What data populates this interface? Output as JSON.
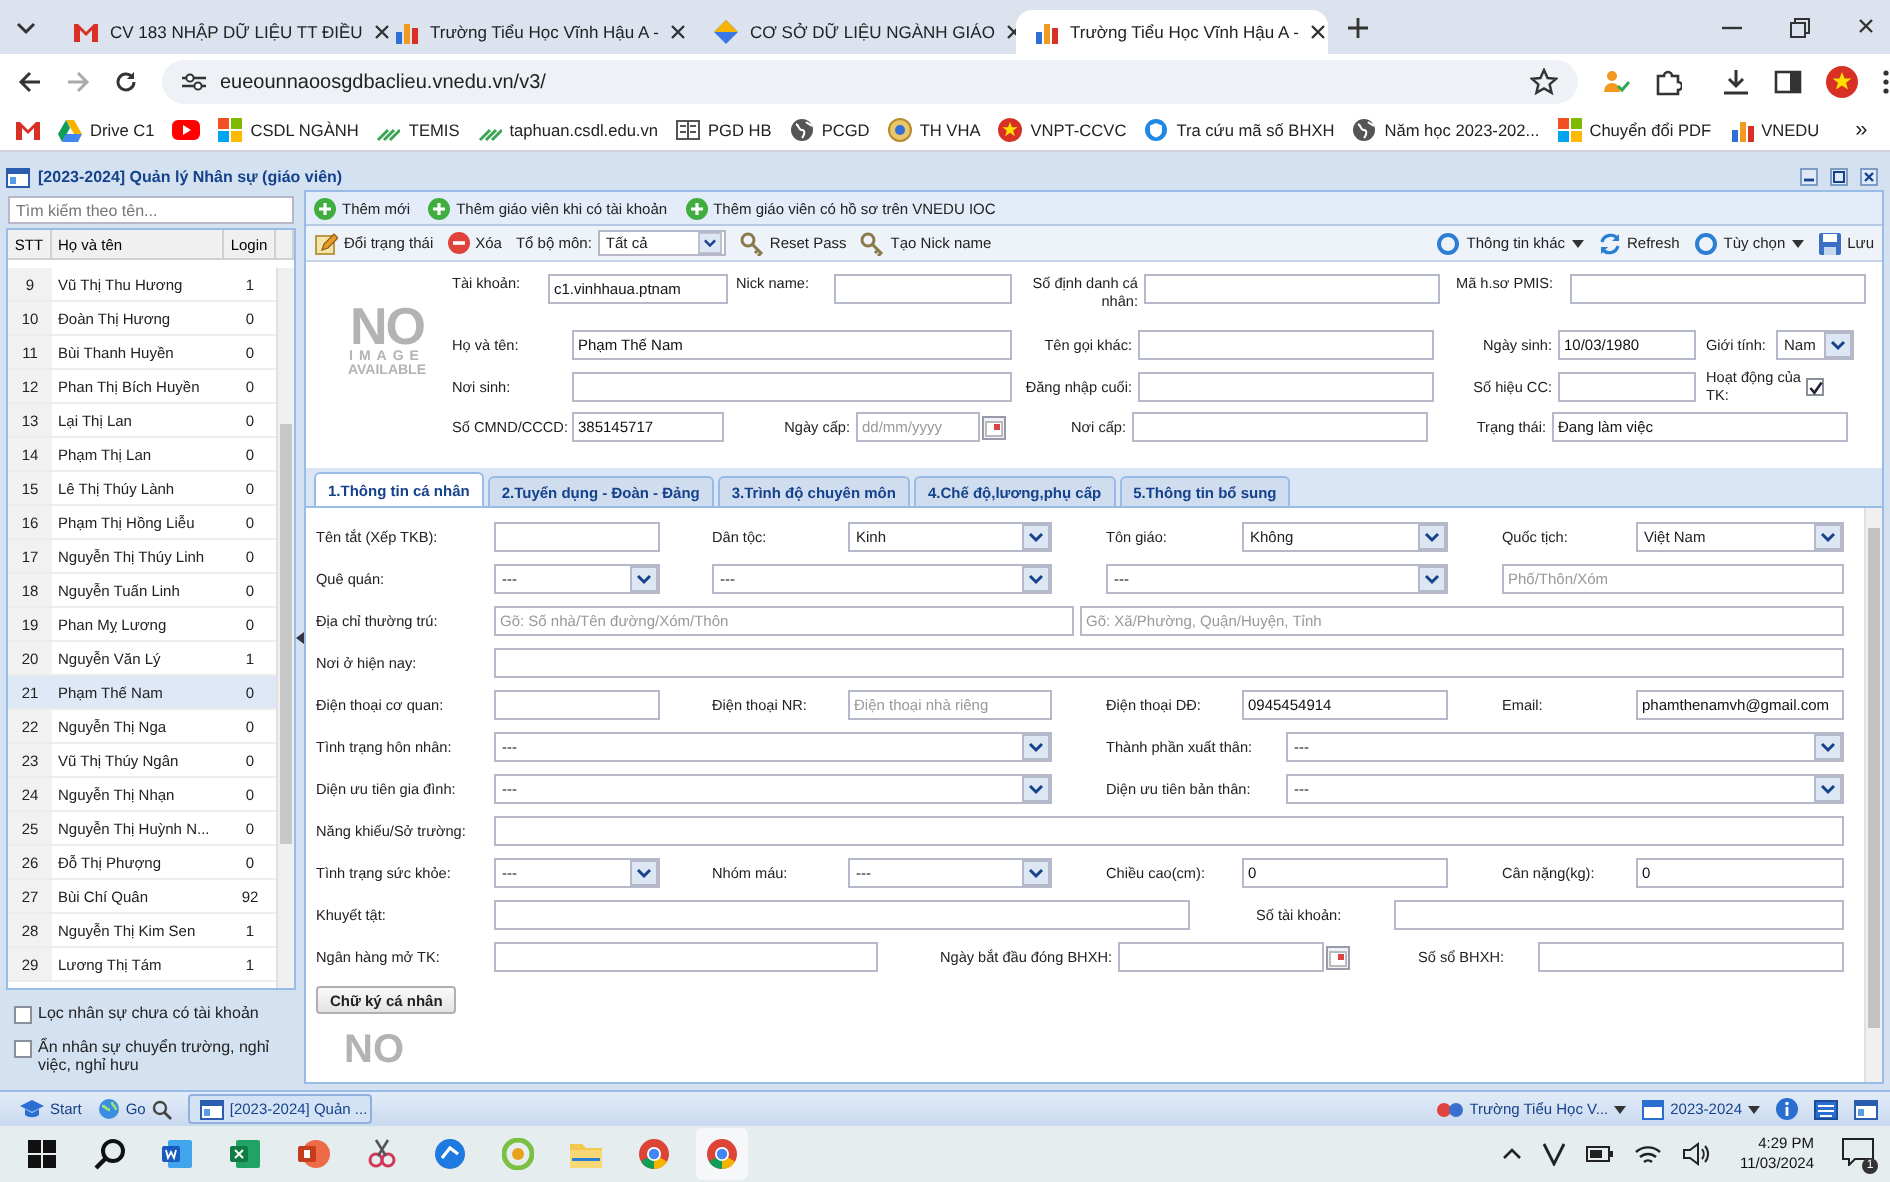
{
  "browser": {
    "tabs": [
      {
        "title": "CV 183 NHẬP DỮ LIỆU TT ĐIỀU",
        "selected": false
      },
      {
        "title": "Trường Tiểu Học Vĩnh Hậu A -",
        "selected": false
      },
      {
        "title": "CƠ SỞ DỮ LIỆU NGÀNH GIÁO",
        "selected": false
      },
      {
        "title": "Trường Tiểu Học Vĩnh Hậu A -",
        "selected": true
      }
    ],
    "address": "eueounnaoosgdbaclieu.vnedu.vn/v3/",
    "bookmarks": [
      "Drive C1",
      "CSDL NGÀNH",
      "TEMIS",
      "taphuan.csdl.edu.vn",
      "PGD HB",
      "PCGD",
      "TH VHA",
      "VNPT-CCVC",
      "Tra cứu mã số BHXH",
      "Năm học 2023-202...",
      "Chuyển đổi PDF",
      "VNEDU"
    ],
    "more": "»"
  },
  "app": {
    "title": "[2023-2024] Quản lý Nhân sự (giáo viên)",
    "sidebar": {
      "search_placeholder": "Tìm kiếm theo tên...",
      "columns": [
        "STT",
        "Họ và tên",
        "Login"
      ],
      "rows": [
        {
          "stt": "9",
          "name": "Vũ Thị Thu Hương",
          "login": "1",
          "selected": false
        },
        {
          "stt": "10",
          "name": "Đoàn Thị Hương",
          "login": "0",
          "selected": false
        },
        {
          "stt": "11",
          "name": "Bùi Thanh Huyền",
          "login": "0",
          "selected": false
        },
        {
          "stt": "12",
          "name": "Phan Thị Bích Huyền",
          "login": "0",
          "selected": false
        },
        {
          "stt": "13",
          "name": "Lại Thị Lan",
          "login": "0",
          "selected": false
        },
        {
          "stt": "14",
          "name": "Phạm Thị Lan",
          "login": "0",
          "selected": false
        },
        {
          "stt": "15",
          "name": "Lê Thị Thúy Lành",
          "login": "0",
          "selected": false
        },
        {
          "stt": "16",
          "name": "Phạm Thị Hồng Liễu",
          "login": "0",
          "selected": false
        },
        {
          "stt": "17",
          "name": "Nguyễn Thị Thúy Linh",
          "login": "0",
          "selected": false
        },
        {
          "stt": "18",
          "name": "Nguyễn Tuấn Linh",
          "login": "0",
          "selected": false
        },
        {
          "stt": "19",
          "name": "Phan Mỵ Lương",
          "login": "0",
          "selected": false
        },
        {
          "stt": "20",
          "name": "Nguyễn Văn Lý",
          "login": "1",
          "selected": false
        },
        {
          "stt": "21",
          "name": "Phạm Thế Nam",
          "login": "0",
          "selected": true
        },
        {
          "stt": "22",
          "name": "Nguyễn Thị Nga",
          "login": "0",
          "selected": false
        },
        {
          "stt": "23",
          "name": "Vũ Thị Thúy Ngân",
          "login": "0",
          "selected": false
        },
        {
          "stt": "24",
          "name": "Nguyễn Thị Nhạn",
          "login": "0",
          "selected": false
        },
        {
          "stt": "25",
          "name": "Nguyễn Thị Huỳnh N...",
          "login": "0",
          "selected": false
        },
        {
          "stt": "26",
          "name": "Đỗ Thị Phượng",
          "login": "0",
          "selected": false
        },
        {
          "stt": "27",
          "name": "Bùi Chí Quân",
          "login": "92",
          "selected": false
        },
        {
          "stt": "28",
          "name": "Nguyễn Thị Kim Sen",
          "login": "1",
          "selected": false
        },
        {
          "stt": "29",
          "name": "Lương Thị Tám",
          "login": "1",
          "selected": false
        }
      ],
      "filters": [
        {
          "label": "Lọc nhân sự chưa có tài khoản",
          "checked": false
        },
        {
          "label": "Ẩn nhân sự chuyển trường, nghỉ việc, nghỉ hưu",
          "checked": false
        }
      ]
    },
    "toolbar_1": [
      "Thêm mới",
      "Thêm giáo viên khi có tài khoản",
      "Thêm giáo viên có hồ sơ trên VNEDU IOC"
    ],
    "toolbar_2": {
      "left": [
        {
          "kind": "button",
          "label": "Đổi trạng thái"
        },
        {
          "kind": "button",
          "label": "Xóa"
        },
        {
          "kind": "label",
          "label": "Tổ bộ môn:"
        },
        {
          "kind": "select",
          "label": "Tất cả"
        },
        {
          "kind": "button",
          "label": "Reset Pass"
        },
        {
          "kind": "button",
          "label": "Tạo Nick name"
        }
      ],
      "right": [
        {
          "kind": "menu",
          "label": "Thông tin khác"
        },
        {
          "kind": "button",
          "label": "Refresh"
        },
        {
          "kind": "menu",
          "label": "Tùy chọn"
        },
        {
          "kind": "button",
          "label": "Lưu"
        }
      ]
    },
    "profile": {
      "photo": [
        "NO",
        "IMAGE",
        "AVAILABLE"
      ],
      "rows": [
        {
          "fields": [
            {
              "label": "Tài khoản:",
              "kind": "text",
              "value": "c1.vinhhaua.ptnam"
            },
            {
              "label": "Nick name:",
              "kind": "text"
            },
            {
              "label": "Số định danh cá nhân:",
              "kind": "text"
            },
            {
              "label": "Mã h.sơ PMIS:",
              "kind": "text"
            }
          ]
        },
        {
          "fields": [
            {
              "label": "Họ và tên:",
              "kind": "text",
              "value": "Phạm Thế Nam"
            },
            {
              "label": "Tên gọi khác:",
              "kind": "text"
            },
            {
              "label": "Ngày sinh:",
              "kind": "text",
              "value": "10/03/1980"
            },
            {
              "label": "Giới tính:",
              "kind": "select",
              "value": "Nam"
            }
          ]
        },
        {
          "fields": [
            {
              "label": "Nơi sinh:",
              "kind": "text"
            },
            {
              "label": "Đăng nhập cuối:",
              "kind": "text"
            },
            {
              "label": "Số hiệu CC:",
              "kind": "text"
            },
            {
              "label": "Hoạt động của TK:",
              "kind": "checkbox",
              "checked": true
            }
          ]
        },
        {
          "fields": [
            {
              "label": "Số CMND/CCCD:",
              "kind": "text",
              "value": "385145717"
            },
            {
              "label": "Ngày cấp:",
              "kind": "date",
              "placeholder": "dd/mm/yyyy"
            },
            {
              "label": "Nơi cấp:",
              "kind": "text"
            },
            {
              "label": "Trạng thái:",
              "kind": "text",
              "value": "Đang làm việc"
            }
          ]
        }
      ]
    },
    "tabs": [
      {
        "label": "1.Thông tin cá nhân",
        "selected": true
      },
      {
        "label": "2.Tuyển dụng - Đoàn - Đảng",
        "selected": false
      },
      {
        "label": "3.Trình độ chuyên môn",
        "selected": false
      },
      {
        "label": "4.Chế độ,lương,phụ cấp",
        "selected": false
      },
      {
        "label": "5.Thông tin bổ sung",
        "selected": false
      }
    ],
    "personal": {
      "rows": [
        {
          "fields": [
            {
              "label": "Tên tắt (Xếp TKB):",
              "kind": "text"
            },
            {
              "label": "Dân tộc:",
              "kind": "select",
              "value": "Kinh"
            },
            {
              "label": "Tôn giáo:",
              "kind": "select",
              "value": "Không"
            },
            {
              "label": "Quốc tịch:",
              "kind": "select",
              "value": "Việt Nam"
            }
          ]
        },
        {
          "fields": [
            {
              "label": "Quê quán:",
              "kind": "select",
              "value": "---"
            },
            {
              "kind": "select",
              "value": "---"
            },
            {
              "kind": "select",
              "value": "---"
            },
            {
              "kind": "text",
              "placeholder": "Phố/Thôn/Xóm"
            }
          ]
        },
        {
          "fields": [
            {
              "label": "Địa chỉ thường trú:",
              "kind": "text",
              "placeholder": "Gõ: Số nhà/Tên đường/Xóm/Thôn"
            },
            {
              "kind": "text",
              "placeholder": "Gõ: Xã/Phường, Quận/Huyện, Tỉnh"
            }
          ]
        },
        {
          "fields": [
            {
              "label": "Nơi ở hiện nay:",
              "kind": "text"
            }
          ]
        },
        {
          "fields": [
            {
              "label": "Điện thoại cơ quan:",
              "kind": "text"
            },
            {
              "label": "Điện thoại NR:",
              "kind": "text",
              "placeholder": "Điện thoại nhà riêng"
            },
            {
              "label": "Điện thoại DĐ:",
              "kind": "text",
              "value": "0945454914"
            },
            {
              "label": "Email:",
              "kind": "text",
              "value": "phamthenamvh@gmail.com"
            }
          ]
        },
        {
          "fields": [
            {
              "label": "Tình trạng hôn nhân:",
              "kind": "select",
              "value": "---"
            },
            {
              "label": "Thành phần xuất thân:",
              "kind": "select",
              "value": "---"
            }
          ]
        },
        {
          "fields": [
            {
              "label": "Diện ưu tiên gia đình:",
              "kind": "select",
              "value": "---"
            },
            {
              "label": "Diện ưu tiên bản thân:",
              "kind": "select",
              "value": "---"
            }
          ]
        },
        {
          "fields": [
            {
              "label": "Năng khiếu/Sở trường:",
              "kind": "text"
            }
          ]
        },
        {
          "fields": [
            {
              "label": "Tình trạng sức khỏe:",
              "kind": "select",
              "value": "---"
            },
            {
              "label": "Nhóm máu:",
              "kind": "select",
              "value": "---"
            },
            {
              "label": "Chiều cao(cm):",
              "kind": "text",
              "value": "0"
            },
            {
              "label": "Cân nặng(kg):",
              "kind": "text",
              "value": "0"
            }
          ]
        },
        {
          "fields": [
            {
              "label": "Khuyết tật:",
              "kind": "text"
            },
            {
              "label": "Số tài khoản:",
              "kind": "text"
            }
          ]
        },
        {
          "fields": [
            {
              "label": "Ngân hàng mở TK:",
              "kind": "text"
            },
            {
              "label": "Ngày bắt đầu đóng BHXH:",
              "kind": "date"
            },
            {
              "label": "Số sổ BHXH:",
              "kind": "text"
            }
          ]
        }
      ],
      "signature_button": "Chữ ký cá nhân",
      "signature_placeholder": "NO"
    }
  },
  "app_taskbar": {
    "start": "Start",
    "go": "Go",
    "windows": [
      {
        "label": "[2023-2024] Quản ...",
        "selected": true
      }
    ],
    "school": "Trường Tiểu Học V...",
    "year": "2023-2024"
  },
  "taskbar": {
    "time": "4:29 PM",
    "date": "11/03/2024",
    "notifications": "1"
  }
}
